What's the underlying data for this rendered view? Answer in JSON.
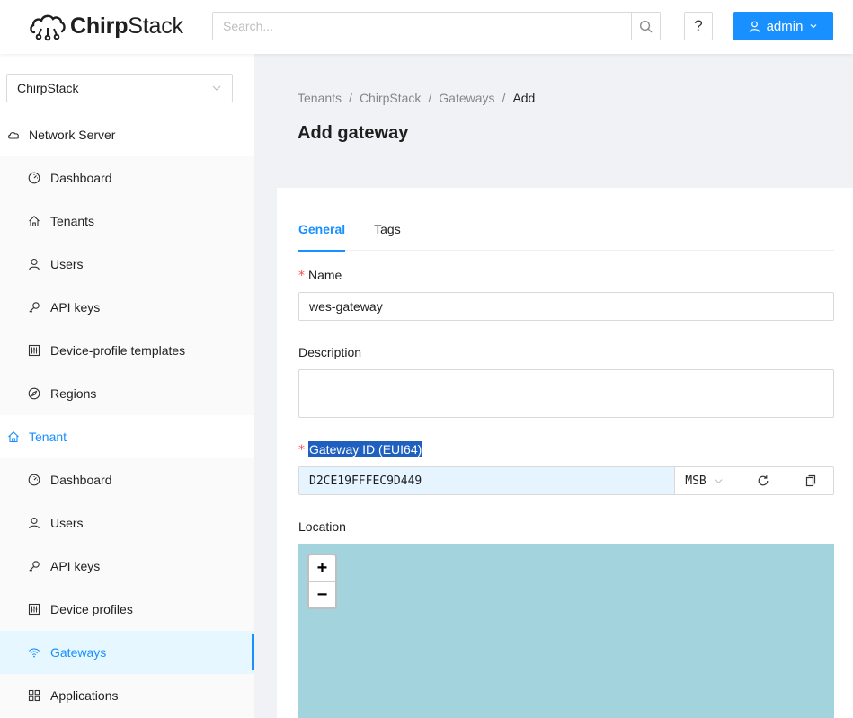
{
  "header": {
    "logo_text_bold": "Chirp",
    "logo_text_light": "Stack",
    "search_placeholder": "Search...",
    "help_label": "?",
    "user_label": "admin"
  },
  "sidebar": {
    "tenant_select": "ChirpStack",
    "network_server": {
      "label": "Network Server",
      "items": [
        "Dashboard",
        "Tenants",
        "Users",
        "API keys",
        "Device-profile templates",
        "Regions"
      ]
    },
    "tenant": {
      "label": "Tenant",
      "items": [
        "Dashboard",
        "Users",
        "API keys",
        "Device profiles",
        "Gateways",
        "Applications"
      ],
      "active": "Gateways"
    }
  },
  "breadcrumb": [
    "Tenants",
    "/",
    "ChirpStack",
    "/",
    "Gateways",
    "/",
    "Add"
  ],
  "page_title": "Add gateway",
  "tabs": [
    "General",
    "Tags"
  ],
  "form": {
    "required_mark": "*",
    "name_label": "Name",
    "name_value": "wes-gateway",
    "description_label": "Description",
    "gateway_id_label": "Gateway ID (EUI64)",
    "gateway_id_value": "D2CE19FFFEC9D449",
    "byte_order": "MSB",
    "location_label": "Location"
  },
  "map": {
    "zoom_in": "+",
    "zoom_out": "−"
  },
  "colors": {
    "primary": "#1890ff",
    "map_water": "#a3d3dd",
    "selection": "#1f5fbf"
  }
}
